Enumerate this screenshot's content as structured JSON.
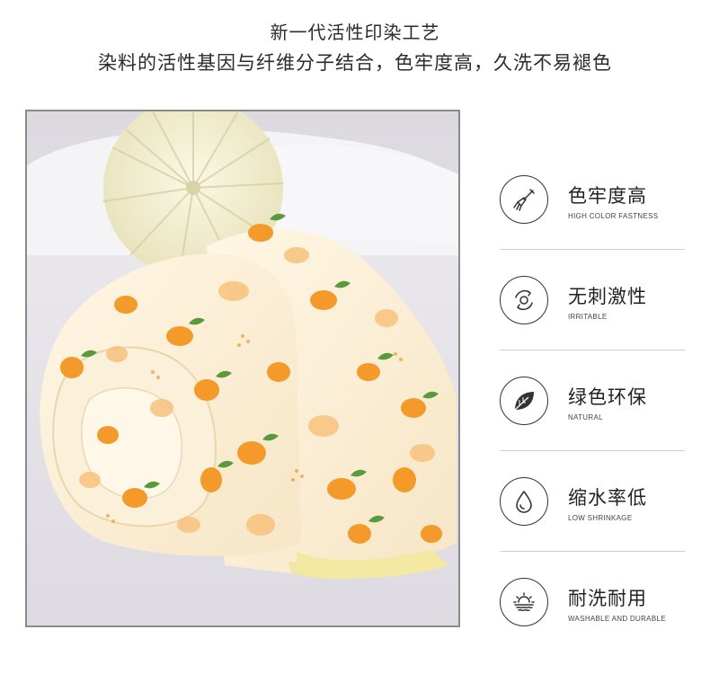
{
  "headline": {
    "line1": "新一代活性印染工艺",
    "line2": "染料的活性基因与纤维分子结合，色牢度高，久洗不易褪色"
  },
  "photo": {
    "subject": "rolled-quilt-with-orange-print"
  },
  "features": [
    {
      "icon": "paintbrush-icon",
      "title": "色牢度高",
      "subtitle": "HIGH COLOR FASTNESS"
    },
    {
      "icon": "circular-arrows-icon",
      "title": "无刺激性",
      "subtitle": "IRRITABLE"
    },
    {
      "icon": "leaf-icon",
      "title": "绿色环保",
      "subtitle": "NATURAL"
    },
    {
      "icon": "water-drop-icon",
      "title": "缩水率低",
      "subtitle": "LOW SHRINKAGE"
    },
    {
      "icon": "sun-waves-icon",
      "title": "耐洗耐用",
      "subtitle": "WASHABLE AND DURABLE"
    }
  ],
  "colors": {
    "text": "#222222",
    "orange": "#f39a2b",
    "cream": "#fbf1dc",
    "pillow": "#f3f1d6"
  }
}
